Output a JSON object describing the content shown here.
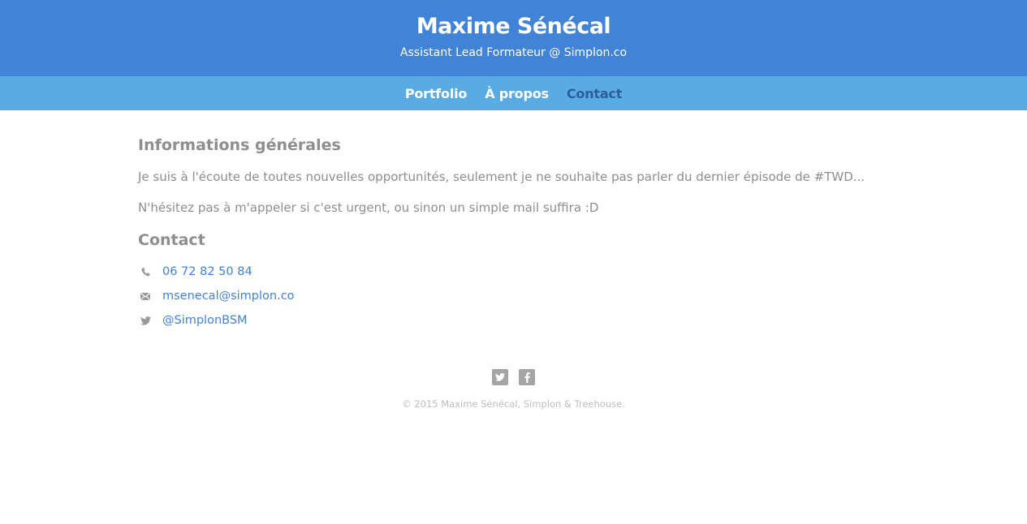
{
  "header": {
    "name": "Maxime Sénécal",
    "tagline": "Assistant Lead Formateur @ Simplon.co"
  },
  "nav": {
    "items": [
      {
        "label": "Portfolio"
      },
      {
        "label": "À propos"
      },
      {
        "label": "Contact"
      }
    ],
    "active": "Contact"
  },
  "main": {
    "info_heading": "Informations générales",
    "paragraph_1": "Je suis à l'écoute de toutes nouvelles opportunités, seulement je ne souhaite pas parler du dernier épisode de #TWD...",
    "paragraph_2": "N'hésitez pas à m'appeler si c'est urgent, ou sinon un simple mail suffira :D",
    "contact_heading": "Contact",
    "contacts": [
      {
        "icon": "phone-icon",
        "text": "06 72 82 50 84"
      },
      {
        "icon": "mail-icon",
        "text": "msenecal@simplon.co"
      },
      {
        "icon": "twitter-icon",
        "text": "@SimplonBSM"
      }
    ]
  },
  "footer": {
    "social": [
      {
        "icon": "twitter-icon"
      },
      {
        "icon": "facebook-icon"
      }
    ],
    "copyright": "© 2015 Maxime Sénécal, Simplon & Treehouse."
  },
  "colors": {
    "header_bg": "#4183d7",
    "nav_bg": "#59abe3",
    "nav_active": "#2e5d9b",
    "link": "#4183d7",
    "text": "#8e8e8e"
  }
}
